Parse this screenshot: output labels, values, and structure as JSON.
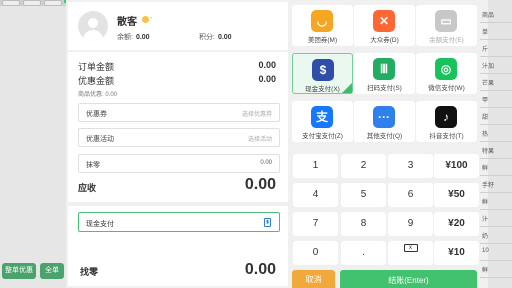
{
  "background": {
    "left_buttons": [
      "整单优惠",
      "全单"
    ],
    "right_items": [
      "商品",
      "单",
      "斤",
      "汁加",
      "芒果",
      "甲",
      "甜",
      "热",
      "特果",
      "鲜",
      "手籽",
      "鲜",
      "汁",
      "奶",
      "10",
      "鲜"
    ]
  },
  "customer": {
    "name": "散客",
    "balance_label": "余额:",
    "balance_value": "0.00",
    "points_label": "积分:",
    "points_value": "0.00"
  },
  "amounts": {
    "order_label": "订单金额",
    "order_value": "0.00",
    "discount_label": "优惠金额",
    "discount_value": "0.00",
    "product_discount": "商品优惠: 0.00",
    "coupon_label": "优惠券",
    "coupon_placeholder": "选择优惠券",
    "promo_label": "优惠活动",
    "promo_placeholder": "选择活动",
    "rounding_label": "抹零",
    "rounding_value": "0.00",
    "receivable_label": "应收",
    "receivable_value": "0.00"
  },
  "payment": {
    "selected_method": "现金支付",
    "change_label": "找零",
    "change_value": "0.00"
  },
  "methods": [
    {
      "label": "美团券(M)",
      "icon": "meituan-icon",
      "glyph": "◡",
      "color": "#f5a623"
    },
    {
      "label": "大众券(D)",
      "icon": "dianping-icon",
      "glyph": "✕",
      "color": "#ff6633"
    },
    {
      "label": "余额支付(E)",
      "icon": "wallet-icon",
      "glyph": "▭",
      "color": "#c8c8c8"
    },
    {
      "label": "现金支付(X)",
      "icon": "cash-bag-icon",
      "glyph": "$",
      "color": "#2f4ea8"
    },
    {
      "label": "扫码支付(S)",
      "icon": "scan-pay-icon",
      "glyph": "Ⅲ",
      "color": "#23ad64"
    },
    {
      "label": "微信支付(W)",
      "icon": "wechat-icon",
      "glyph": "◎",
      "color": "#17c35a"
    },
    {
      "label": "支付宝支付(Z)",
      "icon": "alipay-icon",
      "glyph": "支",
      "color": "#1677ff"
    },
    {
      "label": "其他支付(Q)",
      "icon": "more-icon",
      "glyph": "···",
      "color": "#2f80ed"
    },
    {
      "label": "抖音支付(T)",
      "icon": "douyin-icon",
      "glyph": "♪",
      "color": "#111111"
    }
  ],
  "keypad": [
    [
      "1",
      "2",
      "3",
      "¥100"
    ],
    [
      "4",
      "5",
      "6",
      "¥50"
    ],
    [
      "7",
      "8",
      "9",
      "¥20"
    ],
    [
      "0",
      ".",
      "x",
      "¥10"
    ]
  ],
  "actions": {
    "cancel": "取消",
    "checkout": "结账(Enter)"
  },
  "colors": {
    "accent": "#42c16f",
    "cancel": "#f2a93b"
  }
}
